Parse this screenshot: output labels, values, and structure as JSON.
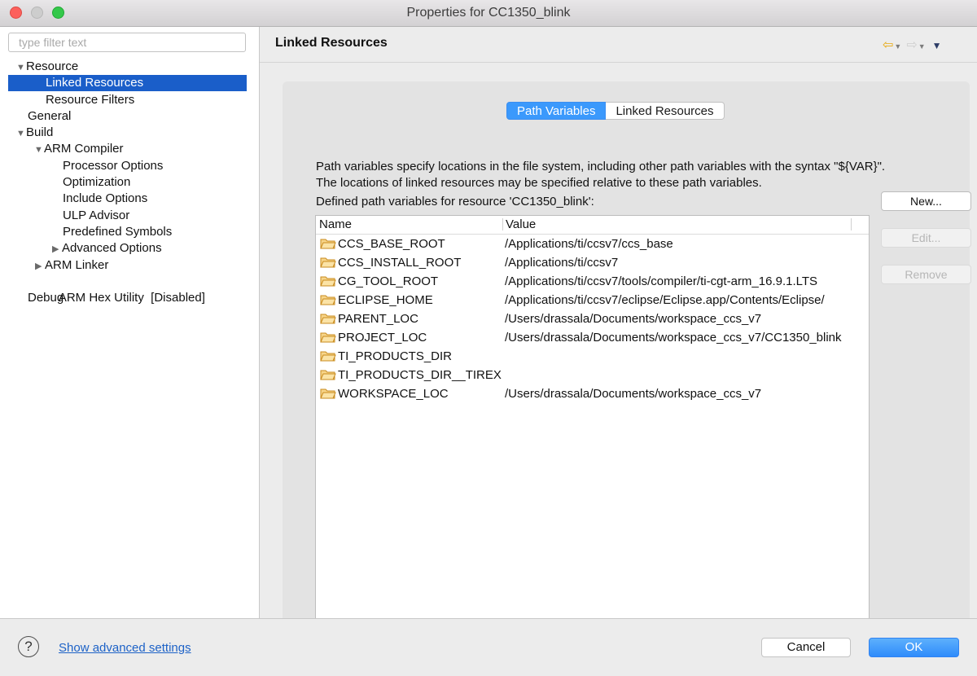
{
  "window": {
    "title": "Properties for CC1350_blink"
  },
  "sidebar": {
    "filter_placeholder": "type filter text",
    "items": [
      {
        "label": "Resource",
        "expander": "▼"
      },
      {
        "label": "Linked Resources",
        "expander": ""
      },
      {
        "label": "Resource Filters",
        "expander": ""
      },
      {
        "label": "General",
        "expander": ""
      },
      {
        "label": "Build",
        "expander": "▼"
      },
      {
        "label": "ARM Compiler",
        "expander": "▼"
      },
      {
        "label": "Processor Options",
        "expander": ""
      },
      {
        "label": "Optimization",
        "expander": ""
      },
      {
        "label": "Include Options",
        "expander": ""
      },
      {
        "label": "ULP Advisor",
        "expander": ""
      },
      {
        "label": "Predefined Symbols",
        "expander": ""
      },
      {
        "label": "Advanced Options",
        "expander": "▶"
      },
      {
        "label": "ARM Linker",
        "expander": "▶"
      },
      {
        "label": "ARM Hex Utility  [Disabled]",
        "expander": ""
      },
      {
        "label": "Debug",
        "expander": ""
      }
    ],
    "selected": "Linked Resources"
  },
  "page": {
    "title": "Linked Resources",
    "nav": {
      "back_icon": "back-arrow",
      "forward_icon": "forward-arrow",
      "menu_icon": "view-menu"
    }
  },
  "tabs": [
    {
      "label": "Path Variables",
      "active": true
    },
    {
      "label": "Linked Resources",
      "active": false
    }
  ],
  "content": {
    "description_line1": "Path variables specify locations in the file system, including other path variables with the syntax \"${VAR}\".",
    "description_line2": "The locations of linked resources may be specified relative to these path variables.",
    "defined_label": "Defined path variables for resource 'CC1350_blink':",
    "table": {
      "headers": [
        "Name",
        "Value"
      ],
      "rows": [
        {
          "name": "CCS_BASE_ROOT",
          "value": "/Applications/ti/ccsv7/ccs_base"
        },
        {
          "name": "CCS_INSTALL_ROOT",
          "value": "/Applications/ti/ccsv7"
        },
        {
          "name": "CG_TOOL_ROOT",
          "value": "/Applications/ti/ccsv7/tools/compiler/ti-cgt-arm_16.9.1.LTS"
        },
        {
          "name": "ECLIPSE_HOME",
          "value": "/Applications/ti/ccsv7/eclipse/Eclipse.app/Contents/Eclipse/"
        },
        {
          "name": "PARENT_LOC",
          "value": "/Users/drassala/Documents/workspace_ccs_v7"
        },
        {
          "name": "PROJECT_LOC",
          "value": "/Users/drassala/Documents/workspace_ccs_v7/CC1350_blink"
        },
        {
          "name": "TI_PRODUCTS_DIR",
          "value": ""
        },
        {
          "name": "TI_PRODUCTS_DIR__TIREX",
          "value": ""
        },
        {
          "name": "WORKSPACE_LOC",
          "value": "/Users/drassala/Documents/workspace_ccs_v7"
        }
      ]
    },
    "buttons": {
      "new": "New...",
      "edit": "Edit...",
      "remove": "Remove"
    }
  },
  "footer": {
    "help_symbol": "?",
    "advanced_link": "Show advanced settings",
    "cancel": "Cancel",
    "ok": "OK"
  },
  "colors": {
    "accent": "#3b99fc",
    "selection": "#1a5ec9",
    "link": "#1d62c7",
    "folder": "#e9a93b"
  }
}
